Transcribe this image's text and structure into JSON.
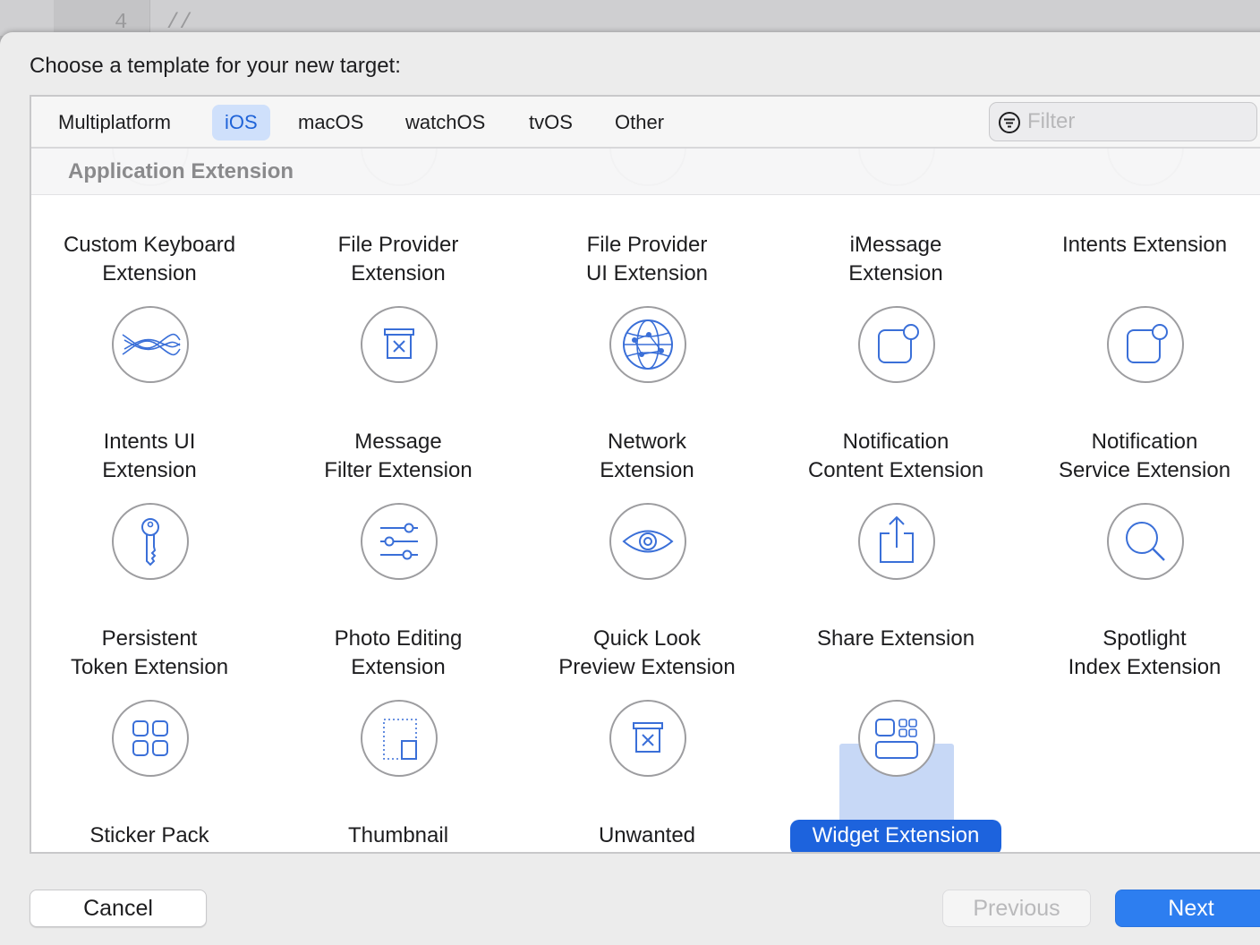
{
  "editor": {
    "line_number": "4",
    "code": "//"
  },
  "dialog": {
    "title": "Choose a template for your new target:"
  },
  "platform_tabs": [
    {
      "label": "Multiplatform",
      "selected": false
    },
    {
      "label": "iOS",
      "selected": true
    },
    {
      "label": "macOS",
      "selected": false
    },
    {
      "label": "watchOS",
      "selected": false
    },
    {
      "label": "tvOS",
      "selected": false
    },
    {
      "label": "Other",
      "selected": false
    }
  ],
  "filter": {
    "placeholder": "Filter",
    "value": ""
  },
  "section": {
    "title": "Application Extension"
  },
  "templates": [
    {
      "label": "Custom Keyboard\nExtension",
      "icon": "keyboard-icon"
    },
    {
      "label": "File Provider\nExtension",
      "icon": "file-provider-icon"
    },
    {
      "label": "File Provider\nUI Extension",
      "icon": "file-provider-ui-icon"
    },
    {
      "label": "iMessage\nExtension",
      "icon": "imessage-icon"
    },
    {
      "label": "Intents Extension",
      "icon": "intents-icon"
    },
    {
      "label": "Intents UI\nExtension",
      "icon": "intents-ui-waves-icon"
    },
    {
      "label": "Message\nFilter Extension",
      "icon": "trash-box-icon"
    },
    {
      "label": "Network\nExtension",
      "icon": "network-globe-icon"
    },
    {
      "label": "Notification\nContent Extension",
      "icon": "notification-badge-icon"
    },
    {
      "label": "Notification\nService Extension",
      "icon": "notification-badge-icon"
    },
    {
      "label": "Persistent\nToken Extension",
      "icon": "key-icon"
    },
    {
      "label": "Photo Editing\nExtension",
      "icon": "sliders-icon"
    },
    {
      "label": "Quick Look\nPreview Extension",
      "icon": "eye-icon"
    },
    {
      "label": "Share Extension",
      "icon": "share-icon"
    },
    {
      "label": "Spotlight\nIndex Extension",
      "icon": "magnifier-icon"
    },
    {
      "label": "Sticker Pack",
      "icon": "sticker-grid-icon"
    },
    {
      "label": "Thumbnail",
      "icon": "thumbnail-icon"
    },
    {
      "label": "Unwanted",
      "icon": "trash-box-icon"
    },
    {
      "label": "Widget Extension",
      "icon": "widget-icon",
      "selected": true
    }
  ],
  "buttons": {
    "cancel": "Cancel",
    "previous": "Previous",
    "next": "Next"
  },
  "colors": {
    "accent": "#2d7ef0",
    "icon_stroke": "#3a6fd8",
    "selection_bg": "#c7d8f6"
  }
}
